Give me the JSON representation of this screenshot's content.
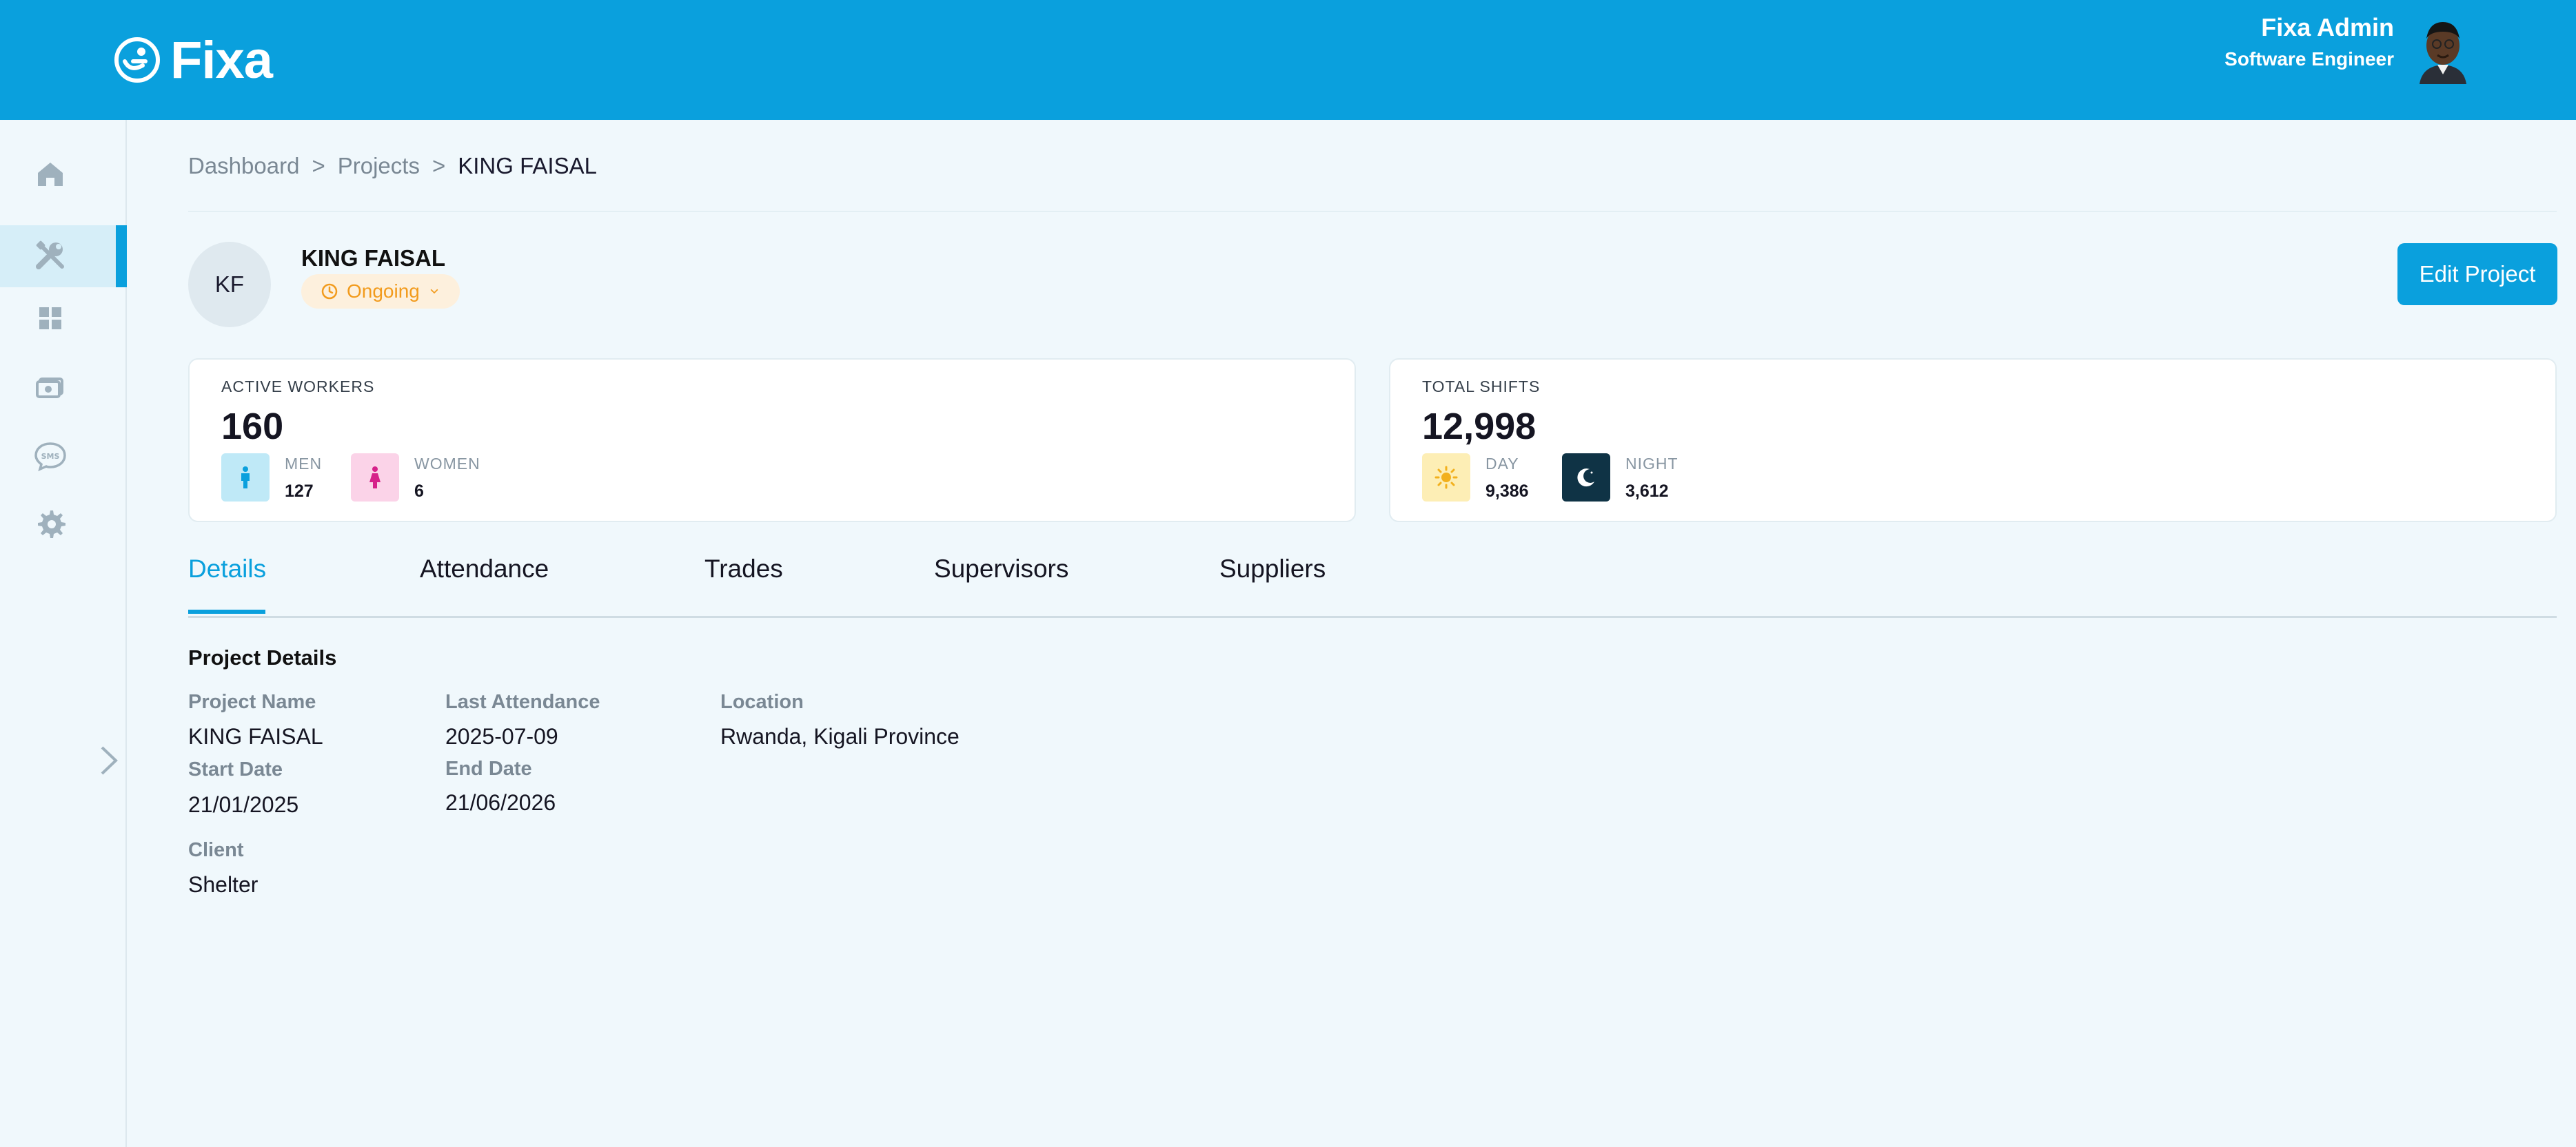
{
  "header": {
    "brand": "Fixa",
    "user_name": "Fixa Admin",
    "user_role": "Software Engineer"
  },
  "sidebar": {
    "items": [
      {
        "icon": "home-icon"
      },
      {
        "icon": "tools-icon",
        "active": true
      },
      {
        "icon": "grid-icon"
      },
      {
        "icon": "payments-icon"
      },
      {
        "icon": "sms-icon"
      },
      {
        "icon": "gear-icon"
      }
    ]
  },
  "breadcrumb": {
    "items": [
      "Dashboard",
      "Projects",
      "KING FAISAL"
    ],
    "separator": ">"
  },
  "project": {
    "initials": "KF",
    "name": "KING FAISAL",
    "status": "Ongoing",
    "edit_label": "Edit Project"
  },
  "stats": {
    "workers": {
      "label": "ACTIVE WORKERS",
      "value": "160",
      "men_label": "MEN",
      "men_value": "127",
      "women_label": "WOMEN",
      "women_value": "6"
    },
    "shifts": {
      "label": "TOTAL SHIFTS",
      "value": "12,998",
      "day_label": "DAY",
      "day_value": "9,386",
      "night_label": "NIGHT",
      "night_value": "3,612"
    }
  },
  "tabs": [
    "Details",
    "Attendance",
    "Trades",
    "Supervisors",
    "Suppliers"
  ],
  "details": {
    "title": "Project Details",
    "project_name_label": "Project Name",
    "project_name": "KING FAISAL",
    "last_attendance_label": "Last Attendance",
    "last_attendance": "2025-07-09",
    "location_label": "Location",
    "location": "Rwanda, Kigali Province",
    "start_date_label": "Start Date",
    "start_date": "21/01/2025",
    "end_date_label": "End Date",
    "end_date": "21/06/2026",
    "client_label": "Client",
    "client": "Shelter"
  },
  "colors": {
    "brand": "#0aa0dd",
    "status_ongoing": "#f29b1d",
    "men_bg": "#bfe9f7",
    "women_bg": "#fbd3e8",
    "day_bg": "#fdeeb5",
    "night_bg": "#0f3345"
  }
}
